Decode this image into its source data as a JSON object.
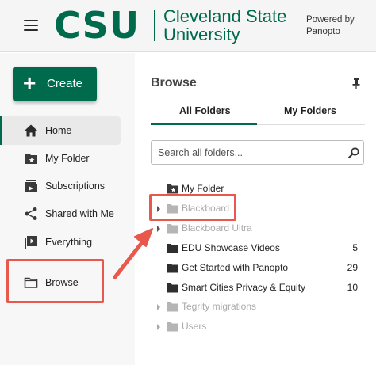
{
  "header": {
    "logo_text": "CSU",
    "university_name_line1": "Cleveland State",
    "university_name_line2": "University",
    "powered_by_line1": "Powered by",
    "powered_by_line2": "Panopto",
    "brand_color": "#006a4d"
  },
  "sidebar": {
    "create_label": "Create",
    "items": [
      {
        "label": "Home",
        "icon": "home-icon",
        "active": true
      },
      {
        "label": "My Folder",
        "icon": "star-folder-icon"
      },
      {
        "label": "Subscriptions",
        "icon": "subscriptions-icon"
      },
      {
        "label": "Shared with Me",
        "icon": "share-icon"
      },
      {
        "label": "Everything",
        "icon": "playlist-icon"
      },
      {
        "label": "Browse",
        "icon": "folder-outline-icon",
        "highlighted": true
      }
    ]
  },
  "main": {
    "title": "Browse",
    "tabs": [
      {
        "label": "All Folders",
        "selected": true
      },
      {
        "label": "My Folders",
        "selected": false
      }
    ],
    "search": {
      "placeholder": "Search all folders..."
    },
    "folders": [
      {
        "label": "My Folder",
        "count": "",
        "expandable": false,
        "dimmed": false
      },
      {
        "label": "Blackboard",
        "count": "",
        "expandable": true,
        "dimmed": true,
        "highlighted": true
      },
      {
        "label": "Blackboard Ultra",
        "count": "",
        "expandable": true,
        "dimmed": true
      },
      {
        "label": "EDU Showcase Videos",
        "count": "5",
        "expandable": false,
        "dimmed": false
      },
      {
        "label": "Get Started with Panopto",
        "count": "29",
        "expandable": false,
        "dimmed": false
      },
      {
        "label": "Smart Cities Privacy & Equity",
        "count": "10",
        "expandable": false,
        "dimmed": false
      },
      {
        "label": "Tegrity migrations",
        "count": "",
        "expandable": true,
        "dimmed": true
      },
      {
        "label": "Users",
        "count": "",
        "expandable": true,
        "dimmed": true
      }
    ]
  },
  "annotation": {
    "highlight_color": "#e8584d"
  }
}
